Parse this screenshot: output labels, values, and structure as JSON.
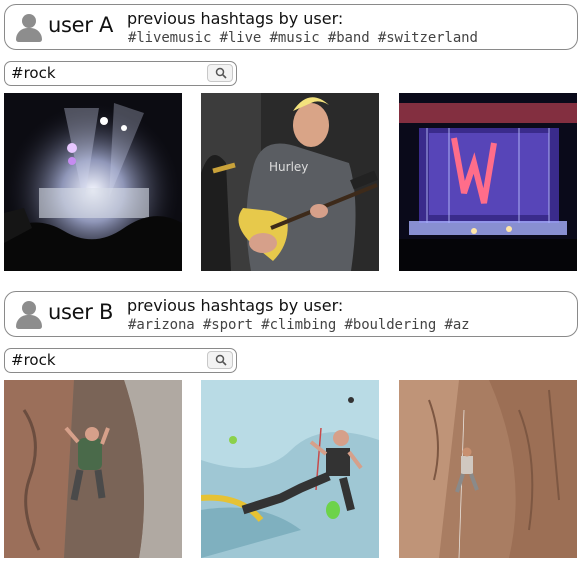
{
  "user_a": {
    "name": "user A",
    "hashtags_title": "previous hashtags by user:",
    "hashtags": "#livemusic #live #music #band #switzerland",
    "search": {
      "value": "#rock"
    },
    "results": [
      {
        "name": "concert-crowd-photo"
      },
      {
        "name": "guitarist-photo"
      },
      {
        "name": "stage-lights-photo"
      }
    ]
  },
  "user_b": {
    "name": "user B",
    "hashtags_title": "previous hashtags by user:",
    "hashtags": "#arizona #sport #climbing #bouldering #az",
    "search": {
      "value": "#rock"
    },
    "results": [
      {
        "name": "outdoor-climber-photo"
      },
      {
        "name": "indoor-wall-climber-photo"
      },
      {
        "name": "cliff-climber-photo"
      }
    ]
  },
  "icons": {
    "avatar": "user-avatar-icon",
    "search": "search-icon"
  },
  "colors": {
    "border": "#8a8a8a",
    "avatar": "#8d8d8d",
    "hashtags": "#444444"
  }
}
